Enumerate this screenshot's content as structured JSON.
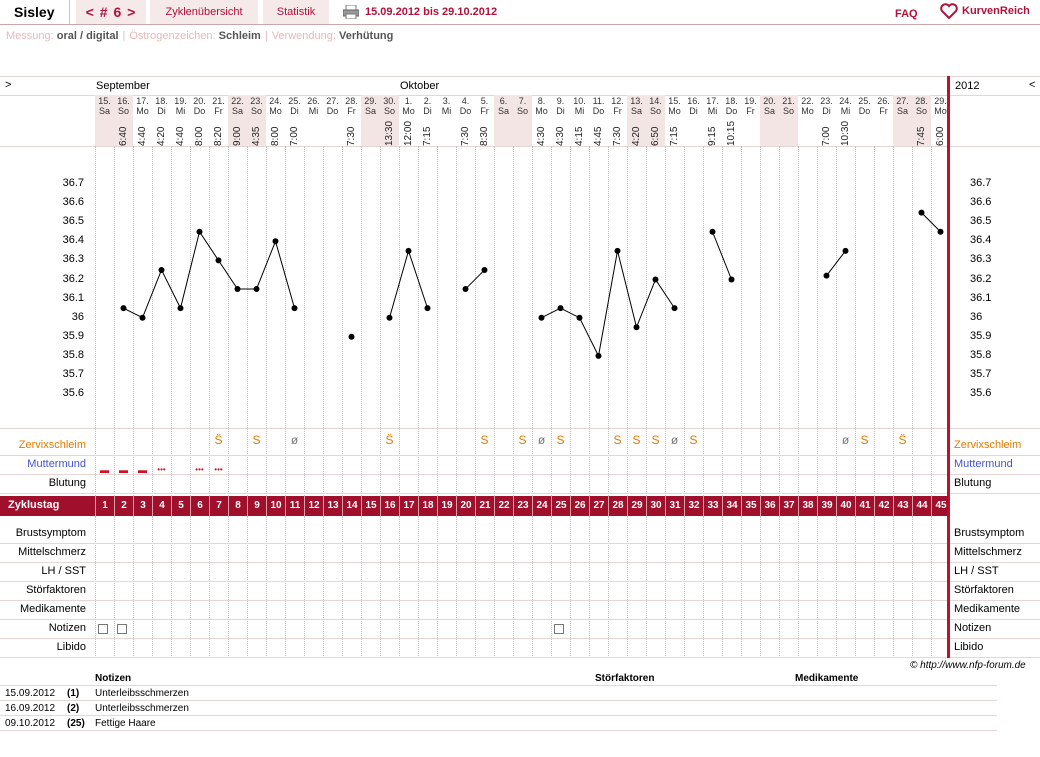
{
  "header": {
    "username": "Sisley",
    "cycle_nav": "< # 6 >",
    "tab_overview": "Zyklenübersicht",
    "tab_stats": "Statistik",
    "date_range": "15.09.2012 bis 29.10.2012",
    "faq": "FAQ",
    "logo": "KurvenReich"
  },
  "settings": {
    "measure_label": "Messung:",
    "measure_value": "oral / digital",
    "estrogen_label": "Östrogenzeichen:",
    "estrogen_value": "Schleim",
    "use_label": "Verwendung:",
    "use_value": "Verhütung"
  },
  "nav": {
    "left_arrow": ">",
    "right_arrow": "<",
    "month1": "September",
    "month2": "Oktober",
    "year": "2012"
  },
  "days": [
    {
      "d": "15.",
      "w": "Sa",
      "t": "",
      "we": true
    },
    {
      "d": "16.",
      "w": "So",
      "t": "6:40",
      "we": true
    },
    {
      "d": "17.",
      "w": "Mo",
      "t": "4:40"
    },
    {
      "d": "18.",
      "w": "Di",
      "t": "4:20"
    },
    {
      "d": "19.",
      "w": "Mi",
      "t": "4:40"
    },
    {
      "d": "20.",
      "w": "Do",
      "t": "8:00"
    },
    {
      "d": "21.",
      "w": "Fr",
      "t": "8:20"
    },
    {
      "d": "22.",
      "w": "Sa",
      "t": "9:00",
      "we": true
    },
    {
      "d": "23.",
      "w": "So",
      "t": "4:35",
      "we": true
    },
    {
      "d": "24.",
      "w": "Mo",
      "t": "8:00"
    },
    {
      "d": "25.",
      "w": "Di",
      "t": "7:00"
    },
    {
      "d": "26.",
      "w": "Mi",
      "t": ""
    },
    {
      "d": "27.",
      "w": "Do",
      "t": ""
    },
    {
      "d": "28.",
      "w": "Fr",
      "t": "7:30"
    },
    {
      "d": "29.",
      "w": "Sa",
      "t": "",
      "we": true
    },
    {
      "d": "30.",
      "w": "So",
      "t": "13:30",
      "we": true
    },
    {
      "d": "1.",
      "w": "Mo",
      "t": "12:00"
    },
    {
      "d": "2.",
      "w": "Di",
      "t": "7:15"
    },
    {
      "d": "3.",
      "w": "Mi",
      "t": ""
    },
    {
      "d": "4.",
      "w": "Do",
      "t": "7:30"
    },
    {
      "d": "5.",
      "w": "Fr",
      "t": "8:30"
    },
    {
      "d": "6.",
      "w": "Sa",
      "t": "",
      "we": true
    },
    {
      "d": "7.",
      "w": "So",
      "t": "",
      "we": true
    },
    {
      "d": "8.",
      "w": "Mo",
      "t": "4:30"
    },
    {
      "d": "9.",
      "w": "Di",
      "t": "4:30"
    },
    {
      "d": "10.",
      "w": "Mi",
      "t": "4:15"
    },
    {
      "d": "11.",
      "w": "Do",
      "t": "4:45"
    },
    {
      "d": "12.",
      "w": "Fr",
      "t": "7:30"
    },
    {
      "d": "13.",
      "w": "Sa",
      "t": "4:20",
      "we": true
    },
    {
      "d": "14.",
      "w": "So",
      "t": "6:50",
      "we": true
    },
    {
      "d": "15.",
      "w": "Mo",
      "t": "7:15"
    },
    {
      "d": "16.",
      "w": "Di",
      "t": ""
    },
    {
      "d": "17.",
      "w": "Mi",
      "t": "9:15"
    },
    {
      "d": "18.",
      "w": "Do",
      "t": "10:15"
    },
    {
      "d": "19.",
      "w": "Fr",
      "t": ""
    },
    {
      "d": "20.",
      "w": "Sa",
      "t": "",
      "we": true
    },
    {
      "d": "21.",
      "w": "So",
      "t": "",
      "we": true
    },
    {
      "d": "22.",
      "w": "Mo",
      "t": ""
    },
    {
      "d": "23.",
      "w": "Di",
      "t": "7:00"
    },
    {
      "d": "24.",
      "w": "Mi",
      "t": "10:30"
    },
    {
      "d": "25.",
      "w": "Do",
      "t": ""
    },
    {
      "d": "26.",
      "w": "Fr",
      "t": ""
    },
    {
      "d": "27.",
      "w": "Sa",
      "t": "",
      "we": true
    },
    {
      "d": "28.",
      "w": "So",
      "t": "7:45",
      "we": true
    },
    {
      "d": "29.",
      "w": "Mo",
      "t": "6:00"
    }
  ],
  "chart_data": {
    "type": "line",
    "ylabels": [
      "36.7",
      "36.6",
      "36.5",
      "36.4",
      "36.3",
      "36.2",
      "36.1",
      "36",
      "35.9",
      "35.8",
      "35.7",
      "35.6"
    ],
    "ylim": [
      35.5,
      36.8
    ],
    "temps": [
      null,
      36.05,
      36.0,
      36.25,
      36.05,
      36.45,
      36.3,
      36.15,
      36.15,
      36.4,
      36.05,
      null,
      null,
      35.9,
      null,
      36.0,
      36.35,
      36.05,
      null,
      36.15,
      36.25,
      null,
      null,
      36.0,
      36.05,
      36.0,
      35.8,
      36.35,
      35.95,
      36.2,
      36.05,
      null,
      36.45,
      36.2,
      null,
      null,
      null,
      null,
      36.22,
      36.35,
      null,
      null,
      null,
      36.55,
      36.45
    ],
    "segments": [
      [
        1,
        10
      ],
      [
        15,
        17
      ],
      [
        19,
        20
      ],
      [
        23,
        30
      ],
      [
        32,
        33
      ],
      [
        38,
        39
      ],
      [
        43,
        44
      ]
    ]
  },
  "rows": {
    "zervix": "Zervixschleim",
    "muttermund": "Muttermund",
    "blutung": "Blutung",
    "zyklustag": "Zyklustag",
    "brust": "Brustsymptom",
    "mittel": "Mittelschmerz",
    "lh": "LH / SST",
    "stoer": "Störfaktoren",
    "medi": "Medikamente",
    "notizen": "Notizen",
    "libido": "Libido"
  },
  "zervix_marks": [
    {
      "i": 6,
      "s": "S̈"
    },
    {
      "i": 8,
      "s": "S"
    },
    {
      "i": 10,
      "s": "ø"
    },
    {
      "i": 15,
      "s": "S̈"
    },
    {
      "i": 20,
      "s": "S"
    },
    {
      "i": 22,
      "s": "S"
    },
    {
      "i": 23,
      "s": "ø"
    },
    {
      "i": 24,
      "s": "S"
    },
    {
      "i": 27,
      "s": "S"
    },
    {
      "i": 28,
      "s": "S"
    },
    {
      "i": 29,
      "s": "S"
    },
    {
      "i": 30,
      "s": "ø"
    },
    {
      "i": 31,
      "s": "S"
    },
    {
      "i": 39,
      "s": "ø"
    },
    {
      "i": 40,
      "s": "S"
    },
    {
      "i": 42,
      "s": "S̈"
    }
  ],
  "blutung_marks": [
    {
      "i": 0,
      "s": "▬"
    },
    {
      "i": 1,
      "s": "▬"
    },
    {
      "i": 2,
      "s": "▬"
    },
    {
      "i": 3,
      "s": "•••"
    },
    {
      "i": 5,
      "s": "•••"
    },
    {
      "i": 6,
      "s": "•••"
    }
  ],
  "note_days": [
    0,
    1,
    24
  ],
  "copyright": "© http://www.nfp-forum.de",
  "notes_table": {
    "h_notes": "Notizen",
    "h_stoer": "Störfaktoren",
    "h_medi": "Medikamente",
    "rows": [
      {
        "date": "15.09.2012",
        "day": "(1)",
        "text": "Unterleibsschmerzen"
      },
      {
        "date": "16.09.2012",
        "day": "(2)",
        "text": "Unterleibsschmerzen"
      },
      {
        "date": "09.10.2012",
        "day": "(25)",
        "text": "Fettige Haare"
      }
    ]
  }
}
